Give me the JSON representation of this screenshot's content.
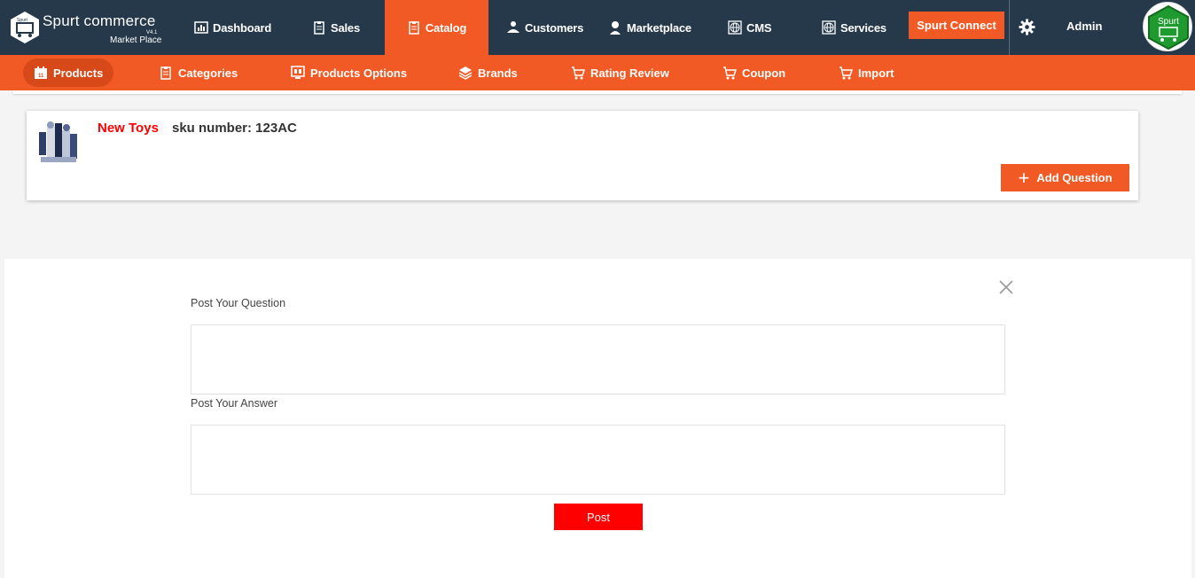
{
  "brand": {
    "name": "Spurt commerce",
    "version": "V4.1",
    "subtitle": "Market Place",
    "logo_text": "Spurt"
  },
  "nav": {
    "items": [
      {
        "label": "Dashboard",
        "icon": "dashboard-icon"
      },
      {
        "label": "Sales",
        "icon": "clipboard-icon"
      },
      {
        "label": "Catalog",
        "icon": "clipboard-icon",
        "active": true
      },
      {
        "label": "Customers",
        "icon": "customers-icon"
      },
      {
        "label": "Marketplace",
        "icon": "user-icon"
      },
      {
        "label": "CMS",
        "icon": "globe-icon"
      },
      {
        "label": "Services",
        "icon": "globe-icon"
      }
    ],
    "connect_label": "Spurt Connect",
    "admin_label": "Admin",
    "avatar_text": "Spurt"
  },
  "subnav": {
    "items": [
      {
        "label": "Products",
        "icon": "calendar-icon",
        "active": true
      },
      {
        "label": "Categories",
        "icon": "clipboard-icon"
      },
      {
        "label": "Products Options",
        "icon": "options-icon"
      },
      {
        "label": "Brands",
        "icon": "layers-icon"
      },
      {
        "label": "Rating Review",
        "icon": "cart-icon"
      },
      {
        "label": "Coupon",
        "icon": "cart-icon"
      },
      {
        "label": "Import",
        "icon": "cart-icon"
      }
    ]
  },
  "product": {
    "name": "New Toys",
    "sku": "sku number: 123AC",
    "add_question_label": "Add Question"
  },
  "form": {
    "question_label": "Post Your Question",
    "answer_label": "Post Your Answer",
    "question_value": "",
    "answer_value": "",
    "post_label": "Post"
  },
  "colors": {
    "nav_bg": "#25394b",
    "accent": "#f15a24",
    "post": "#ff0000"
  }
}
